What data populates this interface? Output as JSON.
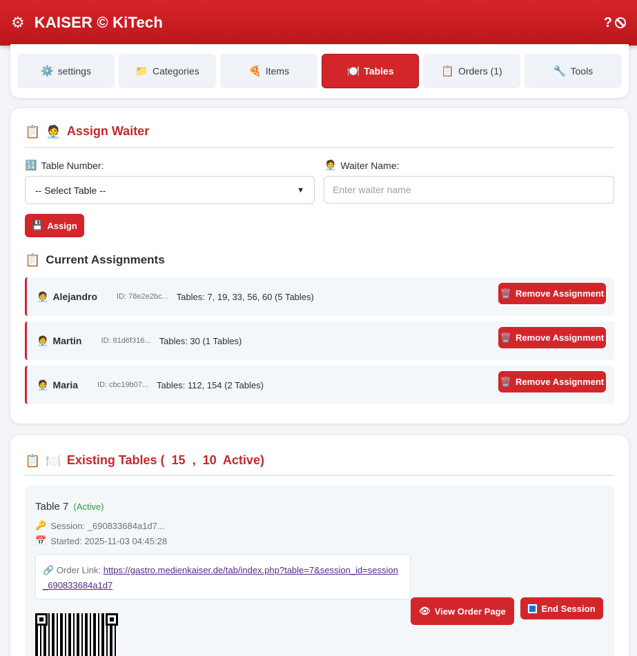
{
  "header": {
    "brand_icon": "gear-icon",
    "title": "KAISER © KiTech",
    "help_label": "?",
    "right_icon": "no-sign-icon"
  },
  "nav": {
    "tabs": [
      {
        "label": "settings",
        "icon": "⚙️",
        "active": false
      },
      {
        "label": "Categories",
        "icon": "📁",
        "active": false
      },
      {
        "label": "Items",
        "icon": "🍕",
        "active": false
      },
      {
        "label": "Tables",
        "icon": "🍽️",
        "active": true
      },
      {
        "label": "Orders (1)",
        "icon": "📋",
        "active": false
      },
      {
        "label": "Tools",
        "icon": "🔧",
        "active": false
      }
    ]
  },
  "assign": {
    "title": "Assign Waiter",
    "title_icons": [
      "📋",
      "🧑‍💼"
    ],
    "table_label": "Table Number:",
    "table_icon": "🔢",
    "table_select_value": "-- Select Table --",
    "waiter_label": "Waiter Name:",
    "waiter_icon": "🧑‍💼",
    "waiter_placeholder": "Enter waiter name",
    "assign_button": "Assign",
    "assign_icon": "💾"
  },
  "assignments": {
    "title": "Current Assignments",
    "title_icon": "📋",
    "remove_label": "Remove Assignment",
    "remove_icon": "🗑️",
    "rows": [
      {
        "name": "Alejandro",
        "id": "ID: 78e2e2bc...",
        "tables": "Tables: 7, 19, 33, 56, 60 (5 Tables)"
      },
      {
        "name": "Martin",
        "id": "ID: 81d6f316...",
        "tables": "Tables: 30 (1 Tables)"
      },
      {
        "name": "Maria",
        "id": "ID: cbc19b07...",
        "tables": "Tables: 112, 154 (2 Tables)"
      }
    ]
  },
  "existing": {
    "title": "Existing Tables (  15  ,  10  Active)",
    "title_icons": [
      "📋",
      "🍽️"
    ],
    "table": {
      "title": "Table 7",
      "status": "(Active)",
      "session": "Session: _690833684a1d7...",
      "started": "Started: 2025-11-03 04:45:28",
      "link_label": "Order Link:",
      "link_url": "https://gastro.medienkaiser.de/tab/index.php?table=7&session_id=session_690833684a1d7",
      "view_button": "View Order Page",
      "end_button": "End Session"
    }
  },
  "colors": {
    "accent": "#d3262b",
    "active_status": "#2e9b43",
    "link": "#5a2a86"
  }
}
